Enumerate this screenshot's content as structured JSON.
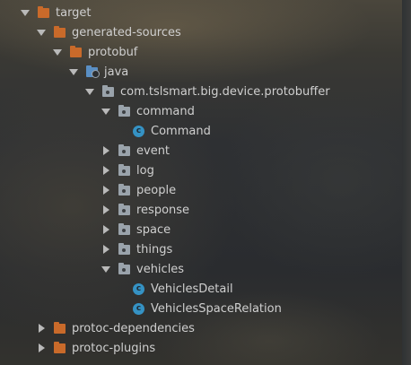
{
  "tree": {
    "target": "target",
    "generated_sources": "generated-sources",
    "protobuf": "protobuf",
    "java": "java",
    "package": "com.tslsmart.big.device.protobuffer",
    "command": "command",
    "command_class": "Command",
    "event": "event",
    "log": "log",
    "people": "people",
    "response": "response",
    "space": "space",
    "things": "things",
    "vehicles": "vehicles",
    "vehicles_detail": "VehiclesDetail",
    "vehicles_space_relation": "VehiclesSpaceRelation",
    "protoc_dependencies": "protoc-dependencies",
    "protoc_plugins": "protoc-plugins"
  },
  "icons": {
    "folder": "folder-icon",
    "package": "package-icon",
    "source_root": "source-folder-icon",
    "class": "class-icon",
    "expand": "chevron-down-icon",
    "collapse": "chevron-right-icon"
  },
  "colors": {
    "folder_orange": "#c96a2a",
    "package_gray": "#9aa3ab",
    "source_blue": "#5a8fc4",
    "class_blue": "#3592c4",
    "text": "#cfcfcf"
  }
}
